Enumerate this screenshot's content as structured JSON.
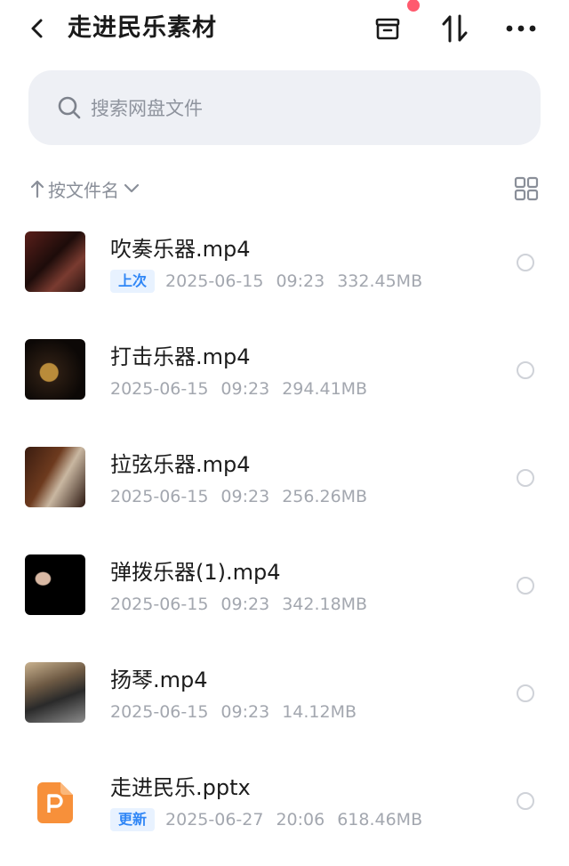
{
  "header": {
    "title": "走进民乐素材",
    "back_icon": "chevron-left-icon",
    "actions": [
      "archive-box-icon",
      "sort-arrows-icon",
      "more-dots-icon"
    ],
    "notification_dot_color": "#ff5a6e"
  },
  "search": {
    "placeholder": "搜索网盘文件",
    "icon": "search-icon"
  },
  "sort": {
    "label": "按文件名",
    "view_toggle_icon": "grid-view-icon"
  },
  "files": [
    {
      "name": "吹奏乐器.mp4",
      "badge": "上次",
      "date": "2025-06-15",
      "time": "09:23",
      "size": "332.45MB",
      "kind": "video-thumbnail"
    },
    {
      "name": "打击乐器.mp4",
      "badge": "",
      "date": "2025-06-15",
      "time": "09:23",
      "size": "294.41MB",
      "kind": "video-thumbnail"
    },
    {
      "name": "拉弦乐器.mp4",
      "badge": "",
      "date": "2025-06-15",
      "time": "09:23",
      "size": "256.26MB",
      "kind": "video-thumbnail"
    },
    {
      "name": "弹拨乐器(1).mp4",
      "badge": "",
      "date": "2025-06-15",
      "time": "09:23",
      "size": "342.18MB",
      "kind": "video-thumbnail"
    },
    {
      "name": "扬琴.mp4",
      "badge": "",
      "date": "2025-06-15",
      "time": "09:23",
      "size": "14.12MB",
      "kind": "video-thumbnail"
    },
    {
      "name": "走进民乐.pptx",
      "badge": "更新",
      "date": "2025-06-27",
      "time": "20:06",
      "size": "618.46MB",
      "kind": "pptx-icon"
    }
  ],
  "colors": {
    "accent": "#2f86f6",
    "badge_bg": "#e8f2ff",
    "search_bg": "#eef0f5",
    "ppt_orange": "#f7903a"
  }
}
